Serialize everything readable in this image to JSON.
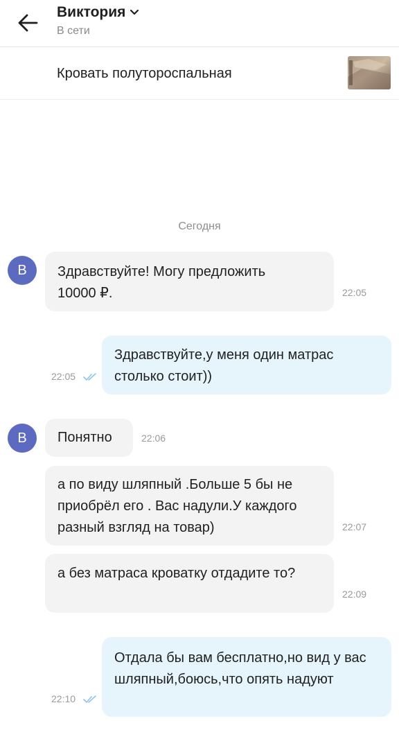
{
  "header": {
    "contact_name": "Виктория",
    "status": "В сети"
  },
  "listing": {
    "title": "Кровать полутороспальная"
  },
  "date_separator": "Сегодня",
  "avatar_letter": "В",
  "colors": {
    "avatar": "#5c6bc0",
    "incoming_bubble": "#f3f3f3",
    "outgoing_bubble": "#e6f5fc",
    "read_checks": "#8ec5e6"
  },
  "messages": [
    {
      "direction": "in",
      "text": "Здравствуйте! Могу предложить 10000 ₽.",
      "time": "22:05"
    },
    {
      "direction": "out",
      "text": "Здравствуйте,у меня один матрас столько стоит))",
      "time": "22:05",
      "read": true
    },
    {
      "direction": "in",
      "text": "Понятно",
      "time": "22:06"
    },
    {
      "direction": "in",
      "text": "а по виду шляпный .Больше 5 бы не приобрёл его . Вас надули.У каждого разный взгляд на товар)",
      "time": "22:07"
    },
    {
      "direction": "in",
      "text": "а без матраса кроватку отдадите то?",
      "time": "22:09"
    },
    {
      "direction": "out",
      "text": "Отдала бы вам бесплатно,но вид у вас шляпный,боюсь,что опять надуют",
      "time": "22:10",
      "read": true
    }
  ]
}
